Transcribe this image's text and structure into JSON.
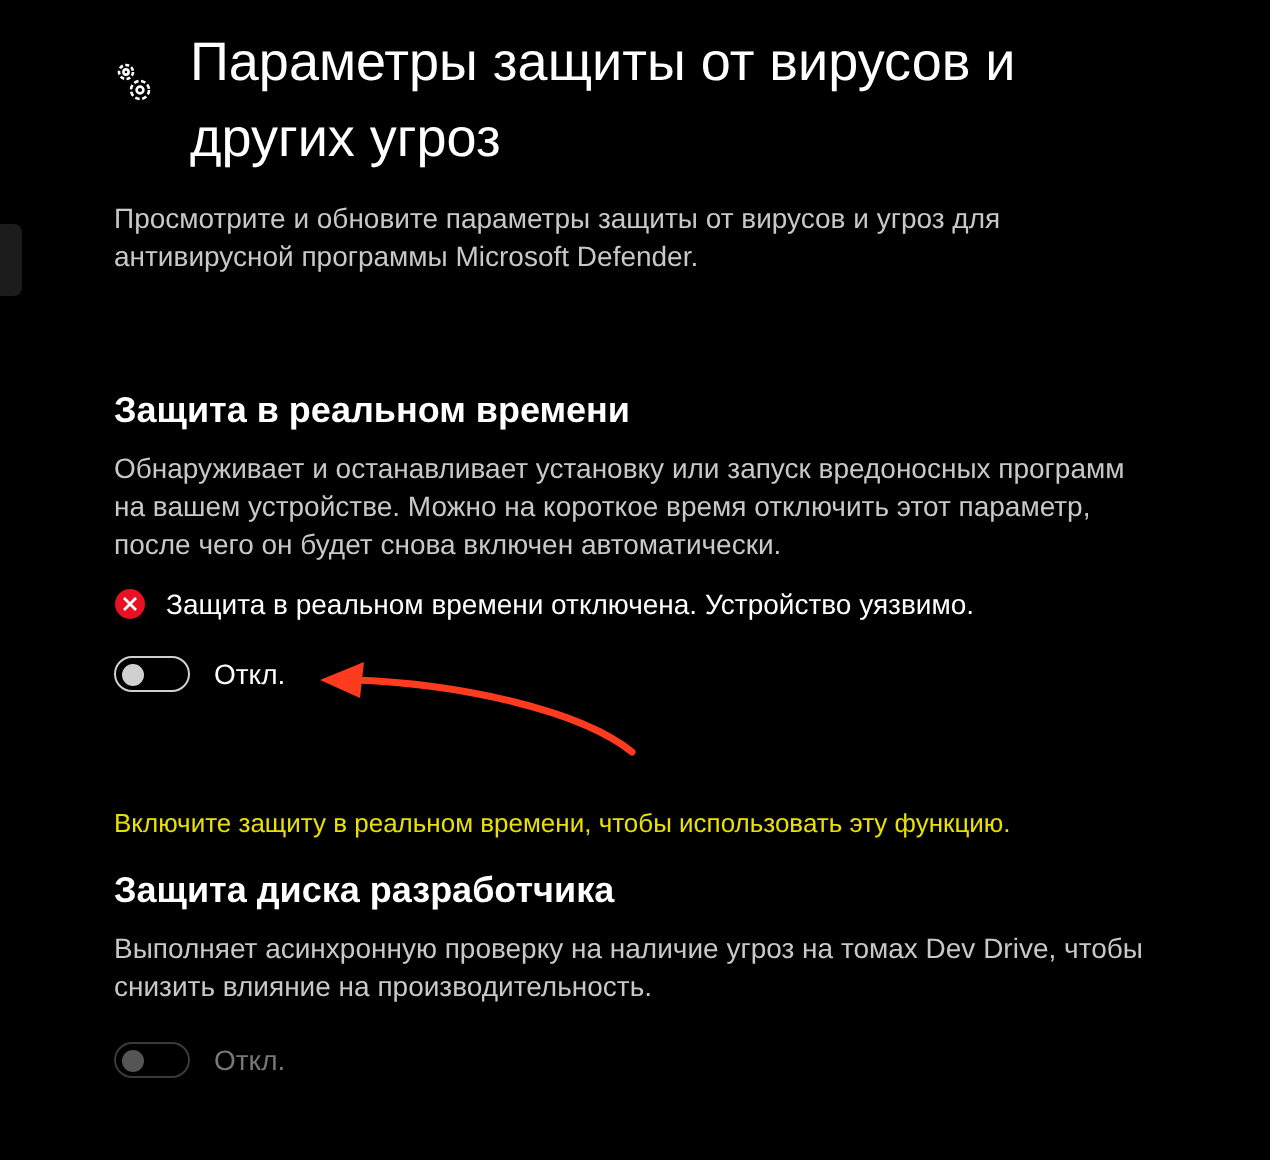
{
  "header": {
    "title": "Параметры защиты от вирусов и других угроз",
    "description": "Просмотрите и обновите параметры защиты от вирусов и угроз для антивирусной программы Microsoft Defender."
  },
  "sections": [
    {
      "heading": "Защита в реальном времени",
      "description": "Обнаруживает и останавливает установку или запуск вредоносных программ на вашем устройстве. Можно на короткое время отключить этот параметр, после чего он будет снова включен автоматически.",
      "status": {
        "kind": "error",
        "text": "Защита в реальном времени отключена. Устройство уязвимо."
      },
      "toggle": {
        "on": false,
        "disabled": false,
        "label": "Откл."
      },
      "notice": "Включите защиту в реальном времени, чтобы использовать эту функцию."
    },
    {
      "heading": "Защита диска разработчика",
      "description": "Выполняет асинхронную проверку на наличие угроз на томах Dev Drive, чтобы снизить влияние на производительность.",
      "toggle": {
        "on": false,
        "disabled": true,
        "label": "Откл."
      }
    }
  ]
}
